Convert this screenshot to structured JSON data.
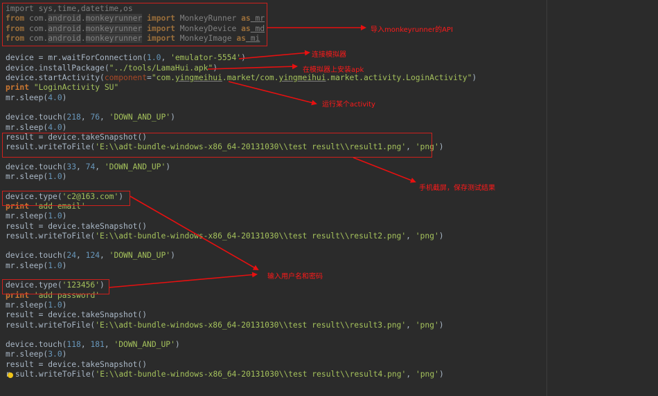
{
  "code": {
    "l01": [
      "import sys,time,datetime,os"
    ],
    "l02": [
      "from",
      " com.",
      "android",
      ".",
      "monkeyrunner",
      " ",
      "import",
      " MonkeyRunner ",
      "as",
      " mr"
    ],
    "l03": [
      "from",
      " com.",
      "android",
      ".",
      "monkeyrunner",
      " ",
      "import",
      " MonkeyDevice ",
      "as",
      " md"
    ],
    "l04": [
      "from",
      " com.",
      "android",
      ".",
      "monkeyrunner",
      " ",
      "import",
      " MonkeyImage ",
      "as",
      " mi"
    ],
    "l06": [
      "device = mr.waitForConnection(",
      "1.0",
      ", ",
      "'emulator-5554'",
      ")"
    ],
    "l07": [
      "device.installPackage(",
      "\"../tools/LamaHui.apk\"",
      ")"
    ],
    "l08": [
      "device.startActivity(",
      "component",
      "=",
      "\"com.",
      "yingmeihui",
      ".market/com.",
      "yingmeihui",
      ".market.activity.LoginActivity\"",
      ")"
    ],
    "l09": [
      "print",
      " ",
      "\"LoginActivity SU\""
    ],
    "l10": [
      "mr.sleep(",
      "4.0",
      ")"
    ],
    "l12": [
      "device.touch(",
      "218",
      ", ",
      "76",
      ", ",
      "'DOWN_AND_UP'",
      ")"
    ],
    "l13": [
      "mr.sleep(",
      "4.0",
      ")"
    ],
    "l14": [
      "result = device.takeSnapshot()"
    ],
    "l15": [
      "result.writeToFile(",
      "'E:\\\\adt-bundle-windows-x86_64-20131030\\\\test result\\\\result1.png'",
      ", ",
      "'png'",
      ")"
    ],
    "l17": [
      "device.touch(",
      "33",
      ", ",
      "74",
      ", ",
      "'DOWN_AND_UP'",
      ")"
    ],
    "l18": [
      "mr.sleep(",
      "1.0",
      ")"
    ],
    "l20": [
      "device.type(",
      "'c2@163.com'",
      ")"
    ],
    "l21": [
      "print",
      " ",
      "'add email'"
    ],
    "l22": [
      "mr.sleep(",
      "1.0",
      ")"
    ],
    "l23": [
      "result = device.takeSnapshot()"
    ],
    "l24": [
      "result.writeToFile(",
      "'E:\\\\adt-bundle-windows-x86_64-20131030\\\\test result\\\\result2.png'",
      ", ",
      "'png'",
      ")"
    ],
    "l26": [
      "device.touch(",
      "24",
      ", ",
      "124",
      ", ",
      "'DOWN_AND_UP'",
      ")"
    ],
    "l27": [
      "mr.sleep(",
      "1.0",
      ")"
    ],
    "l29": [
      "device.type(",
      "'123456'",
      ")"
    ],
    "l30": [
      "print",
      " ",
      "'add password'"
    ],
    "l31": [
      "mr.sleep(",
      "1.0",
      ")"
    ],
    "l32": [
      "result = device.takeSnapshot()"
    ],
    "l33": [
      "result.writeToFile(",
      "'E:\\\\adt-bundle-windows-x86_64-20131030\\\\test result\\\\result3.png'",
      ", ",
      "'png'",
      ")"
    ],
    "l35": [
      "device.touch(",
      "118",
      ", ",
      "181",
      ", ",
      "'DOWN_AND_UP'",
      ")"
    ],
    "l36": [
      "mr.sleep(",
      "3.0",
      ")"
    ],
    "l37": [
      "result = device.takeSnapshot()"
    ],
    "l38": [
      "r",
      "sult.writeToFile(",
      "'E:\\\\adt-bundle-windows-x86_64-20131030\\\\test result\\\\result4.png'",
      ", ",
      "'png'",
      ")"
    ]
  },
  "annotations": {
    "import_api": "导入monkeyrunner的API",
    "connect_emulator": "连接模拟器",
    "install_apk": "在模拟器上安装apk",
    "run_activity": "运行某个activity",
    "screenshot_save": "手机截屏，保存测试结果",
    "enter_credentials": "输入用户名和密码"
  },
  "colors": {
    "background": "#2b2b2b",
    "annotation": "#ff1a1a",
    "keyword": "#cc7832",
    "string": "#a5c25c",
    "number": "#6897bb"
  }
}
